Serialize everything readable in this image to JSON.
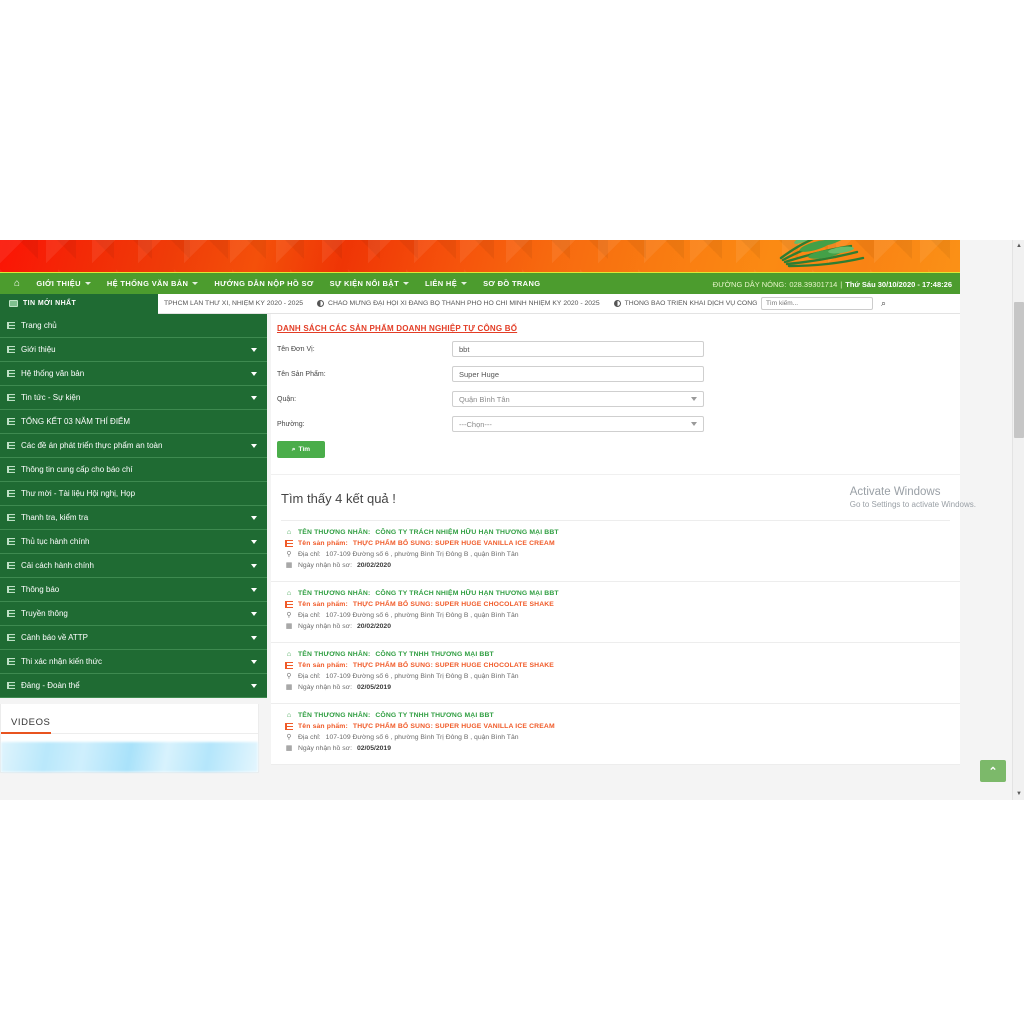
{
  "header": {
    "nav": [
      {
        "name": "home",
        "label": "",
        "icon": "home-icon",
        "caret": false
      },
      {
        "name": "gioi-thieu",
        "label": "GIỚI THIỆU",
        "caret": true
      },
      {
        "name": "he-thong-van-ban",
        "label": "HỆ THỐNG VĂN BẢN",
        "caret": true
      },
      {
        "name": "huong-dan-nop-ho-so",
        "label": "HƯỚNG DẪN NỘP HỒ SƠ",
        "caret": false
      },
      {
        "name": "su-kien-noi-bat",
        "label": "SỰ KIỆN NỔI BẬT",
        "caret": true
      },
      {
        "name": "lien-he",
        "label": "LIÊN HỆ",
        "caret": true
      },
      {
        "name": "so-do-trang",
        "label": "SƠ ĐỒ TRANG",
        "caret": false
      }
    ],
    "hotline_label": "ĐƯỜNG DÂY NÓNG:",
    "hotline_number": "028.39301714",
    "separator": "|",
    "datetime": "Thứ Sáu 30/10/2020 - 17:48:26"
  },
  "ticker": {
    "tag": "TIN MỚI NHẤT",
    "items": [
      "TPHCM LẦN THỨ XI, NHIỆM KỲ 2020 - 2025",
      "CHÀO MỪNG ĐẠI HỘI XI ĐẢNG BỘ THÀNH PHỐ HỒ CHÍ MINH NHIỆM KỲ 2020 - 2025",
      "THÔNG BÁO TRIỂN KHAI DỊCH VỤ CÔNG"
    ],
    "search_placeholder": "Tìm kiếm...",
    "search_value": "",
    "search_icon": "magnifier-icon"
  },
  "sidebar": {
    "items": [
      {
        "label": "Trang chủ",
        "caret": false
      },
      {
        "label": "Giới thiệu",
        "caret": true
      },
      {
        "label": "Hệ thống văn bản",
        "caret": true
      },
      {
        "label": "Tin tức - Sự kiện",
        "caret": true
      },
      {
        "label": "TỔNG KẾT 03 NĂM THÍ ĐIỂM",
        "caret": false
      },
      {
        "label": "Các đề án phát triển thực phẩm an toàn",
        "caret": true
      },
      {
        "label": "Thông tin cung cấp cho báo chí",
        "caret": false
      },
      {
        "label": "Thư mời - Tài liệu Hội nghị, Họp",
        "caret": false
      },
      {
        "label": "Thanh tra, kiểm tra",
        "caret": true
      },
      {
        "label": "Thủ tục hành chính",
        "caret": true
      },
      {
        "label": "Cải cách hành chính",
        "caret": true
      },
      {
        "label": "Thông báo",
        "caret": true
      },
      {
        "label": "Truyền thông",
        "caret": true
      },
      {
        "label": "Cảnh báo về ATTP",
        "caret": true
      },
      {
        "label": "Thi xác nhận kiến thức",
        "caret": true
      },
      {
        "label": "Đảng - Đoàn thể",
        "caret": true
      }
    ],
    "videos_title": "VIDEOS"
  },
  "main": {
    "page_title": "DANH SÁCH CÁC SẢN PHẨM DOANH NGHIỆP TỰ CÔNG BỐ",
    "form": {
      "fields": [
        {
          "label": "Tên Đơn Vị:",
          "type": "text",
          "value": "bbt",
          "placeholder": ""
        },
        {
          "label": "Tên Sản Phẩm:",
          "type": "text",
          "value": "Super Huge",
          "placeholder": ""
        },
        {
          "label": "Quận:",
          "type": "select",
          "value": "Quận Bình Tân"
        },
        {
          "label": "Phường:",
          "type": "select",
          "value": "---Chọn---"
        }
      ],
      "submit_label": "Tìm",
      "submit_icon": "magnifier-icon"
    },
    "results_heading": "Tìm thấy 4 kết quả !",
    "labels": {
      "merchant": "TÊN THƯƠNG NHÂN:",
      "product": "Tên sản phẩm:",
      "address": "Địa chỉ:",
      "date": "Ngày nhận hồ sơ:"
    },
    "results": [
      {
        "merchant": "CÔNG TY TRÁCH NHIỆM HỮU HẠN THƯƠNG MẠI BBT",
        "product": "THỰC PHẨM BỔ SUNG: SUPER HUGE VANILLA ICE CREAM",
        "address": "107-109 Đường số 6 , phường Bình Trị Đông B , quận Bình Tân",
        "date": "20/02/2020"
      },
      {
        "merchant": "CÔNG TY TRÁCH NHIỆM HỮU HẠN THƯƠNG MẠI BBT",
        "product": "THỰC PHẨM BỔ SUNG: SUPER HUGE CHOCOLATE SHAKE",
        "address": "107-109 Đường số 6 , phường Bình Trị Đông B , quận Bình Tân",
        "date": "20/02/2020"
      },
      {
        "merchant": "CÔNG TY TNHH THƯƠNG MẠI BBT",
        "product": "THỰC PHẨM BỔ SUNG: SUPER HUGE CHOCOLATE SHAKE",
        "address": "107-109 Đường số 6 , phường Bình Trị Đông B , quận Bình Tân",
        "date": "02/05/2019"
      },
      {
        "merchant": "CÔNG TY TNHH THƯƠNG MẠI BBT",
        "product": "THỰC PHẨM BỔ SUNG: SUPER HUGE VANILLA ICE CREAM",
        "address": "107-109 Đường số 6 , phường Bình Trị Đông B , quận Bình Tân",
        "date": "02/05/2019"
      }
    ]
  },
  "watermark": {
    "line1": "Activate Windows",
    "line2": "Go to Settings to activate Windows."
  },
  "back_to_top": {
    "icon": "chevron-up-icon",
    "glyph": "⌃"
  },
  "colors": {
    "nav_green": "#4c9c2e",
    "menu_green": "#1f6b33",
    "accent_orange": "#f05a28",
    "accent_red": "#e33d26",
    "merchant_green": "#2f9e41",
    "button_green": "#4aad4a"
  }
}
